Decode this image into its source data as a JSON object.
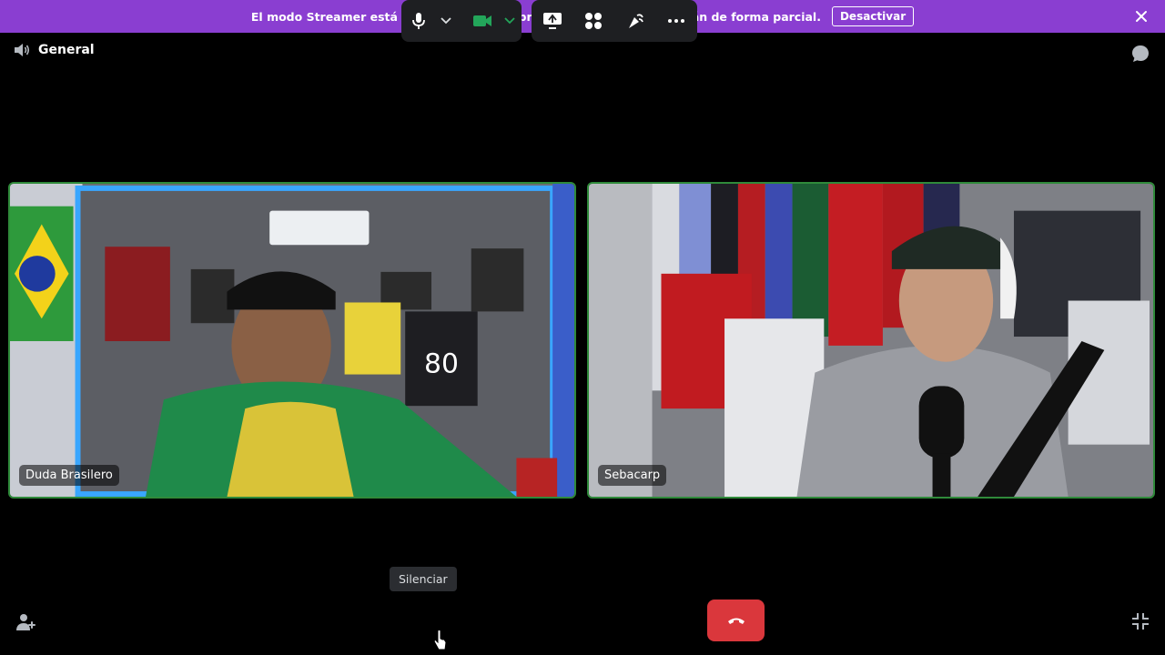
{
  "banner": {
    "message": "El modo Streamer está activado. Los nombres de usuario se mostrarán de forma parcial.",
    "button_label": "Desactivar",
    "color": "#8a3ed1"
  },
  "channel": {
    "name": "General",
    "icon": "speaker-icon"
  },
  "participants": [
    {
      "name": "Duda Brasilero"
    },
    {
      "name": "Sebacarp"
    }
  ],
  "tooltip": {
    "text": "Silenciar"
  },
  "controls": {
    "mic_icon": "microphone-icon",
    "camera_icon": "camera-icon",
    "share_icon": "screen-share-icon",
    "activities_icon": "activities-icon",
    "soundboard_icon": "soundboard-icon",
    "more_icon": "more-icon",
    "hangup_icon": "phone-hangup-icon",
    "hangup_color": "#da373c",
    "speaking_border_color": "#2f8a3a"
  }
}
